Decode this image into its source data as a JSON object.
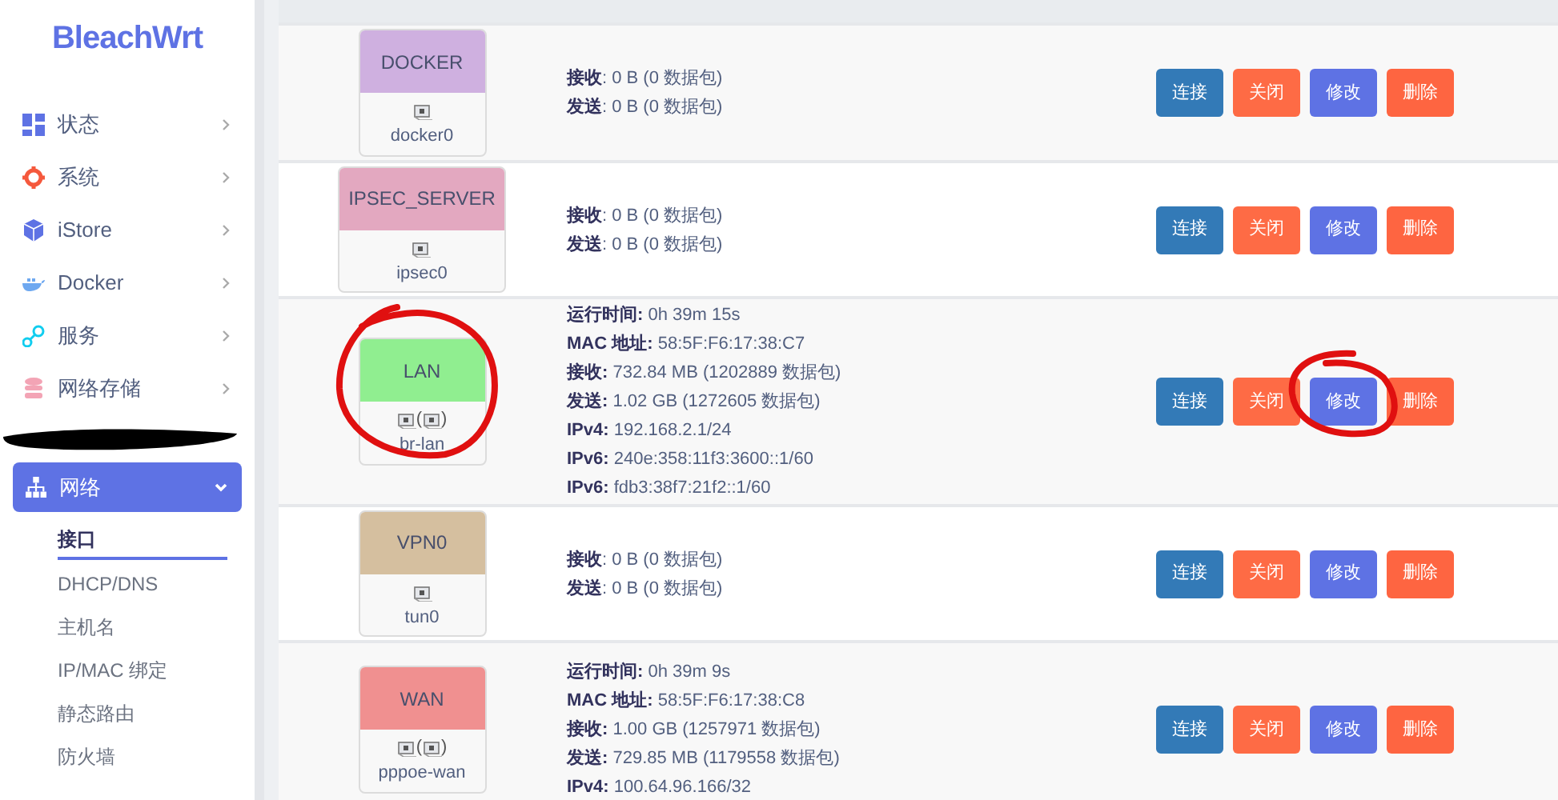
{
  "logo": "BleachWrt",
  "sidebar": {
    "items": [
      {
        "label": "状态",
        "expanded": false
      },
      {
        "label": "系统",
        "expanded": false
      },
      {
        "label": "iStore",
        "expanded": false
      },
      {
        "label": "Docker",
        "expanded": false
      },
      {
        "label": "服务",
        "expanded": false
      },
      {
        "label": "网络存储",
        "expanded": false
      }
    ],
    "active": {
      "label": "网络",
      "expanded": true,
      "children": [
        {
          "label": "接口",
          "selected": true
        },
        {
          "label": "DHCP/DNS",
          "selected": false
        },
        {
          "label": "主机名",
          "selected": false
        },
        {
          "label": "IP/MAC 绑定",
          "selected": false
        },
        {
          "label": "静态路由",
          "selected": false
        },
        {
          "label": "防火墙",
          "selected": false
        }
      ]
    }
  },
  "table": {
    "rows": [
      {
        "name": "DOCKER",
        "color": "#cfb0e0",
        "device": "docker0",
        "icon_group": null,
        "status": [
          {
            "label": "接收",
            "value": ": 0 B (0 数据包)"
          },
          {
            "label": "发送",
            "value": ": 0 B (0 数据包)"
          }
        ],
        "actions": [
          "连接",
          "关闭",
          "修改",
          "删除"
        ]
      },
      {
        "name": "IPSEC_SERVER",
        "color": "#e3a8c0",
        "device": "ipsec0",
        "icon_group": null,
        "status": [
          {
            "label": "接收",
            "value": ": 0 B (0 数据包)"
          },
          {
            "label": "发送",
            "value": ": 0 B (0 数据包)"
          }
        ],
        "actions": [
          "连接",
          "关闭",
          "修改",
          "删除"
        ]
      },
      {
        "name": "LAN",
        "color": "#90ee90",
        "device": "br-lan",
        "icon_group": {
          "open": "(",
          "close": ")"
        },
        "status": [
          {
            "label": "运行时间:",
            "value": " 0h 39m 15s"
          },
          {
            "label": "MAC 地址:",
            "value": " 58:5F:F6:17:38:C7"
          },
          {
            "label": "接收:",
            "value": " 732.84 MB (1202889 数据包)"
          },
          {
            "label": "发送:",
            "value": " 1.02 GB (1272605 数据包)"
          },
          {
            "label": "IPv4:",
            "value": " 192.168.2.1/24"
          },
          {
            "label": "IPv6:",
            "value": " 240e:358:11f3:3600::1/60"
          },
          {
            "label": "IPv6:",
            "value": " fdb3:38f7:21f2::1/60"
          }
        ],
        "actions": [
          "连接",
          "关闭",
          "修改",
          "删除"
        ]
      },
      {
        "name": "VPN0",
        "color": "#d5bf9f",
        "device": "tun0",
        "icon_group": null,
        "status": [
          {
            "label": "接收",
            "value": ": 0 B (0 数据包)"
          },
          {
            "label": "发送",
            "value": ": 0 B (0 数据包)"
          }
        ],
        "actions": [
          "连接",
          "关闭",
          "修改",
          "删除"
        ]
      },
      {
        "name": "WAN",
        "color": "#f09090",
        "device": "pppoe-wan",
        "icon_group": {
          "open": "(",
          "close": ")"
        },
        "status": [
          {
            "label": "运行时间:",
            "value": " 0h 39m 9s"
          },
          {
            "label": "MAC 地址:",
            "value": " 58:5F:F6:17:38:C8"
          },
          {
            "label": "接收:",
            "value": " 1.00 GB (1257971 数据包)"
          },
          {
            "label": "发送:",
            "value": " 729.85 MB (1179558 数据包)"
          },
          {
            "label": "IPv4:",
            "value": " 100.64.96.166/32"
          }
        ],
        "actions": [
          "连接",
          "关闭",
          "修改",
          "删除"
        ]
      }
    ]
  }
}
